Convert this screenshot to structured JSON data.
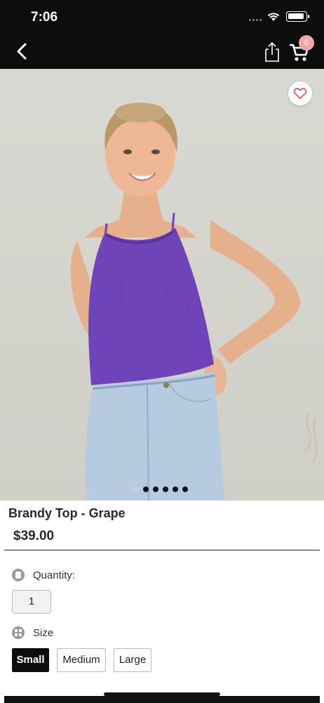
{
  "status_bar": {
    "time": "7:06"
  },
  "nav": {
    "cart_count": "0"
  },
  "product": {
    "title": "Brandy Top - Grape",
    "price": "$39.00",
    "image_dots": 6,
    "active_dot": 0
  },
  "options": {
    "quantity_label": "Quantity:",
    "quantity_value": "1",
    "size_label": "Size",
    "sizes": [
      {
        "label": "Small",
        "selected": true
      },
      {
        "label": "Medium",
        "selected": false
      },
      {
        "label": "Large",
        "selected": false
      }
    ]
  },
  "colors": {
    "accent_badge": "#f2a7a7",
    "heart": "#e0566b",
    "top_color": "#6f44b8"
  }
}
